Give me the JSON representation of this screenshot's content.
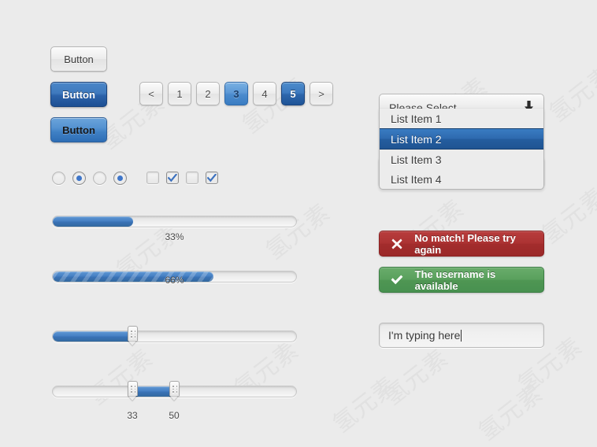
{
  "page": {
    "background_color": "#ebebeb",
    "accent_blue": "#3f7cc2",
    "accent_dark_blue": "#1f5493",
    "error_red": "#a32c2c",
    "success_green": "#4f9653"
  },
  "buttons": [
    {
      "label": "Button",
      "style": "plain"
    },
    {
      "label": "Button",
      "style": "dark"
    },
    {
      "label": "Button",
      "style": "light"
    }
  ],
  "pagination": {
    "prev_label": "<",
    "next_label": ">",
    "pages": [
      {
        "label": "1",
        "state": "normal"
      },
      {
        "label": "2",
        "state": "normal"
      },
      {
        "label": "3",
        "state": "light"
      },
      {
        "label": "4",
        "state": "normal"
      },
      {
        "label": "5",
        "state": "dark"
      }
    ]
  },
  "radios": [
    {
      "checked": false
    },
    {
      "checked": true
    },
    {
      "checked": false
    },
    {
      "checked": true
    }
  ],
  "checkboxes": [
    {
      "checked": false
    },
    {
      "checked": true
    },
    {
      "checked": false
    },
    {
      "checked": true
    }
  ],
  "progress": [
    {
      "value": 33,
      "label": "33%",
      "striped": false
    },
    {
      "value": 66,
      "label": "66%",
      "striped": true
    }
  ],
  "sliders": [
    {
      "type": "single",
      "value": 33,
      "show_label": false
    },
    {
      "type": "range",
      "low": 33,
      "high": 50,
      "low_label": "33",
      "high_label": "50",
      "show_label": true
    }
  ],
  "selects": {
    "closed": {
      "value": "Please Select...",
      "arrow_icon": "arrow-down-icon"
    },
    "open": {
      "value": "Please Select...",
      "arrow_icon": "arrow-down-icon",
      "options": [
        {
          "label": "List Item 1",
          "selected": false
        },
        {
          "label": "List Item 2",
          "selected": true
        },
        {
          "label": "List Item 3",
          "selected": false
        },
        {
          "label": "List Item 4",
          "selected": false
        }
      ]
    }
  },
  "alerts": [
    {
      "type": "error",
      "icon": "cross-icon",
      "message": "No match! Please try again"
    },
    {
      "type": "success",
      "icon": "check-icon",
      "message": "The username is available"
    }
  ],
  "textfield": {
    "value": "I'm typing here",
    "placeholder": "I'm typing here"
  },
  "watermark": {
    "text": "氢元素"
  }
}
